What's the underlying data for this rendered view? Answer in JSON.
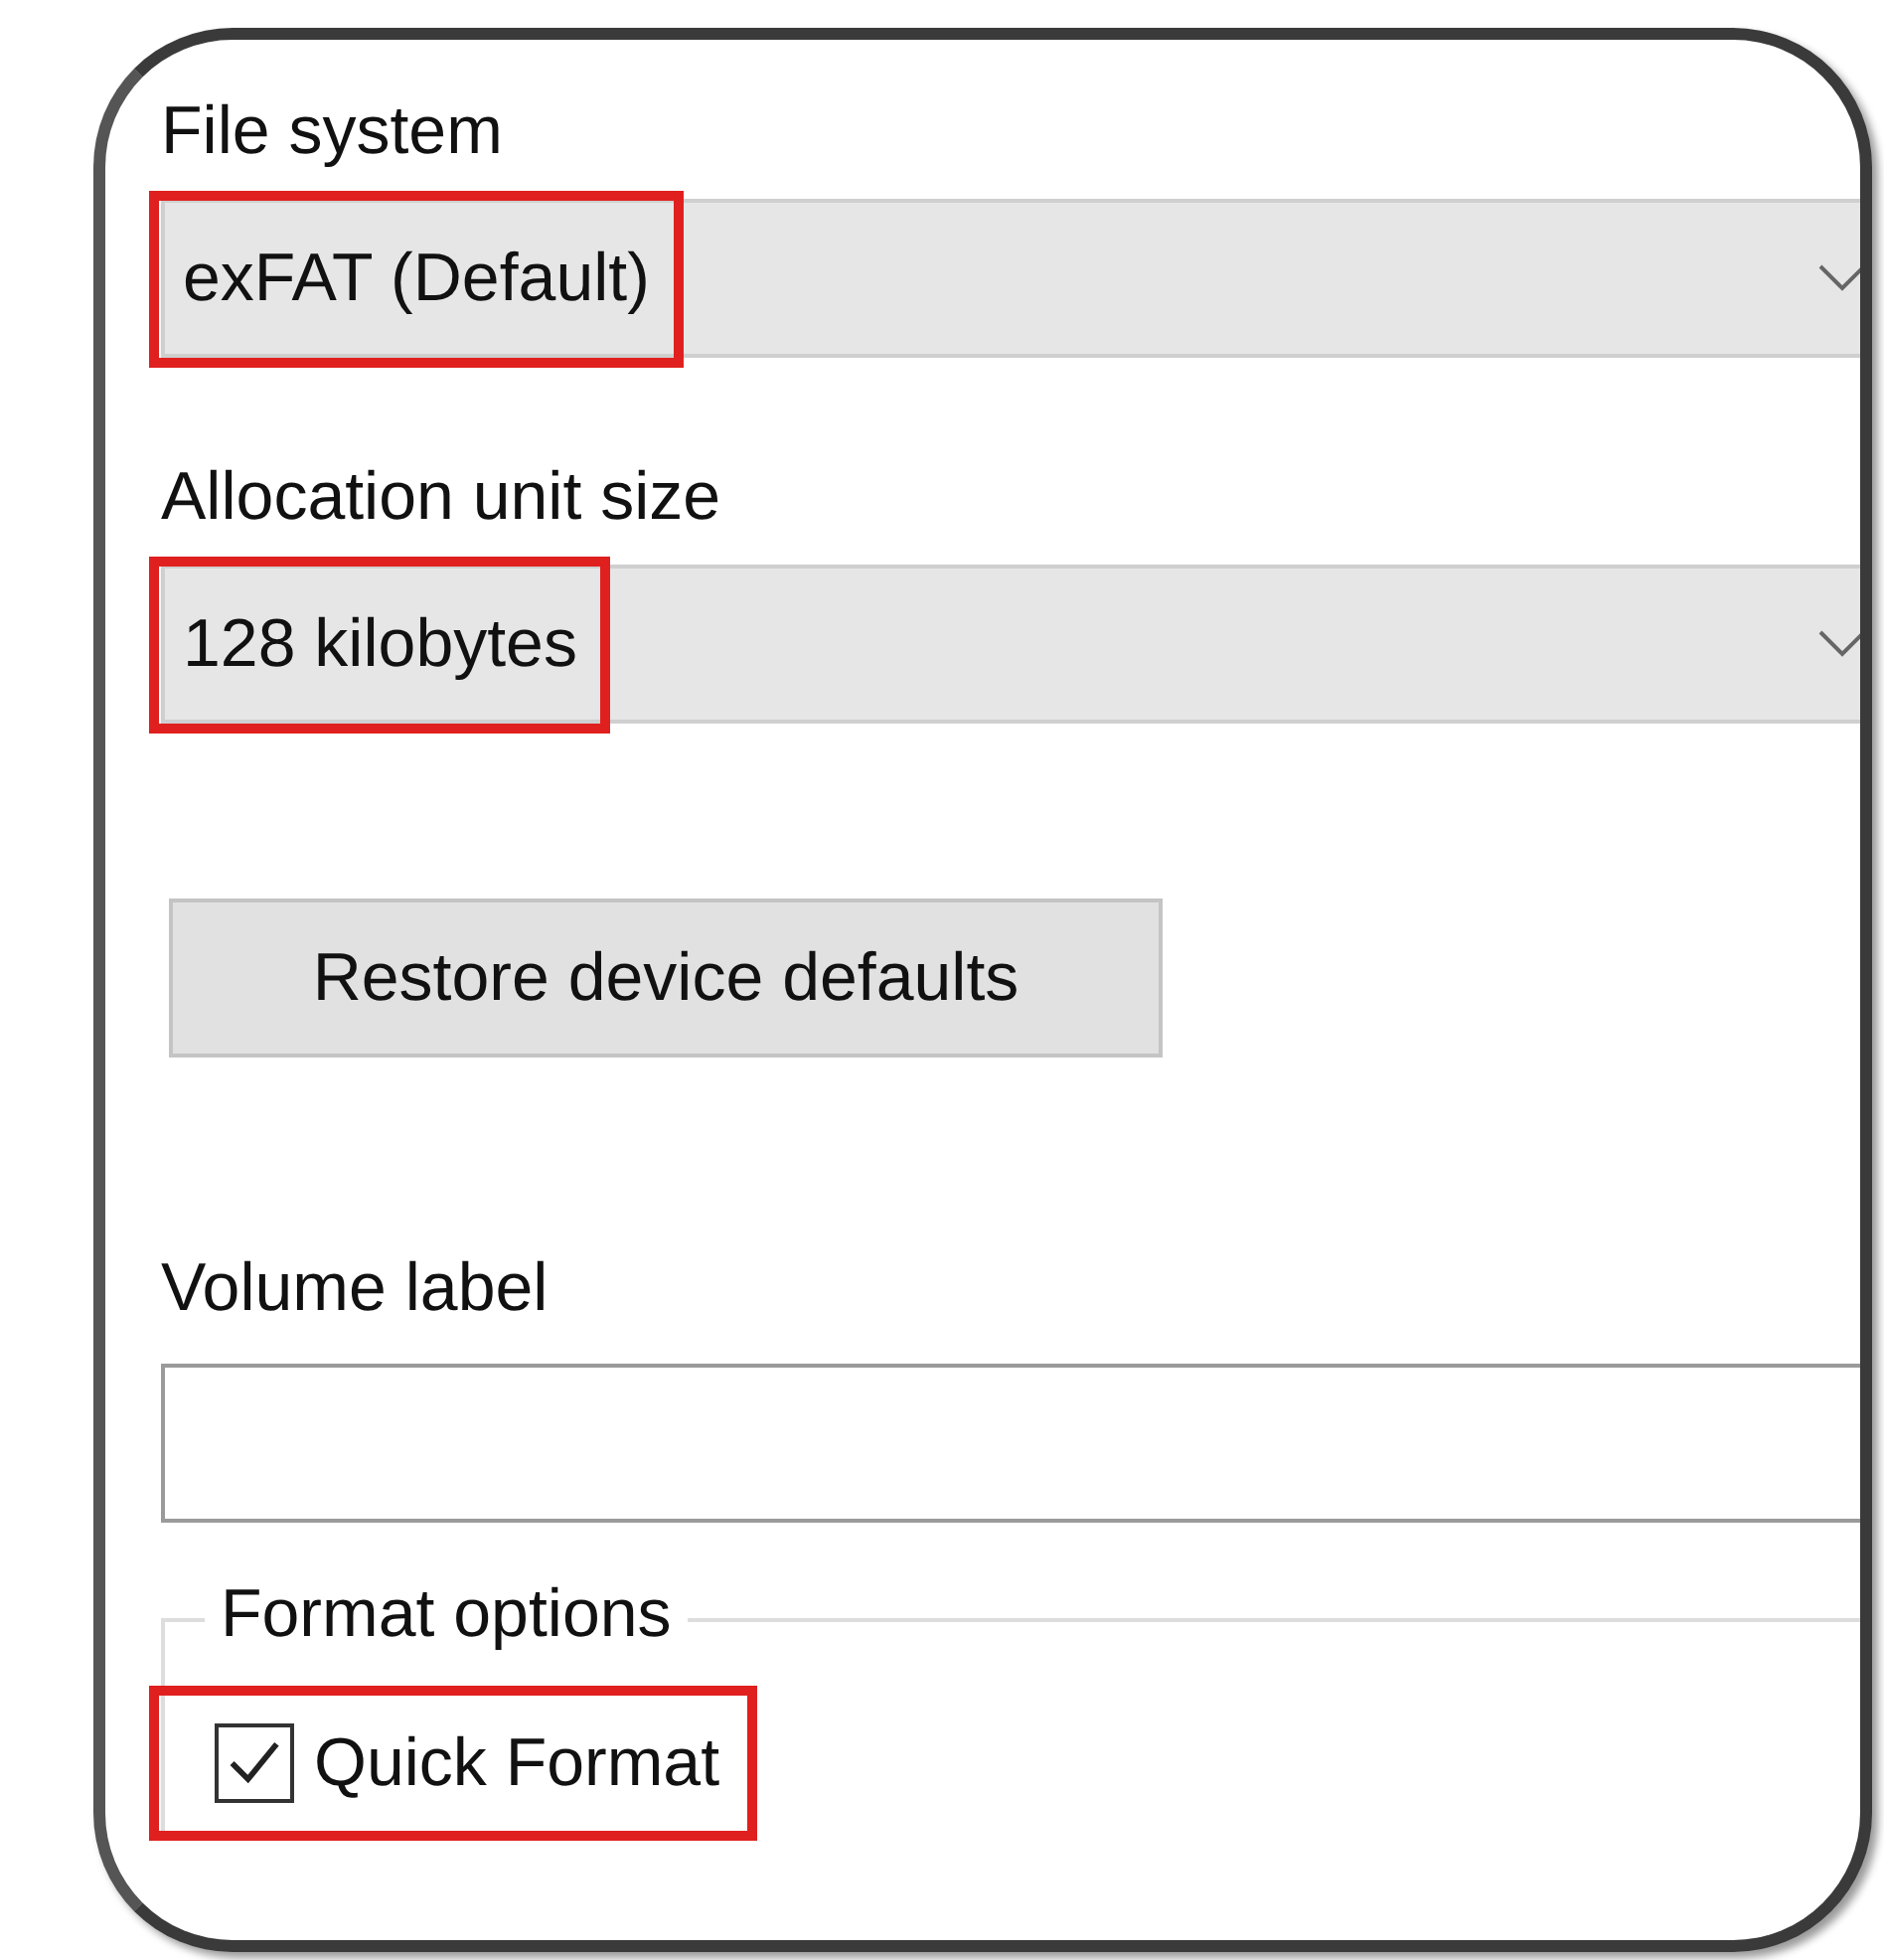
{
  "file_system": {
    "label": "File system",
    "value": "exFAT (Default)",
    "highlighted": true
  },
  "allocation_unit_size": {
    "label": "Allocation unit size",
    "value": "128 kilobytes",
    "highlighted": true
  },
  "restore_button": {
    "label": "Restore device defaults"
  },
  "volume_label": {
    "label": "Volume label"
  },
  "format_options": {
    "title": "Format options",
    "options": [
      {
        "label": "Quick Format",
        "checked": true,
        "highlighted": true
      }
    ]
  }
}
